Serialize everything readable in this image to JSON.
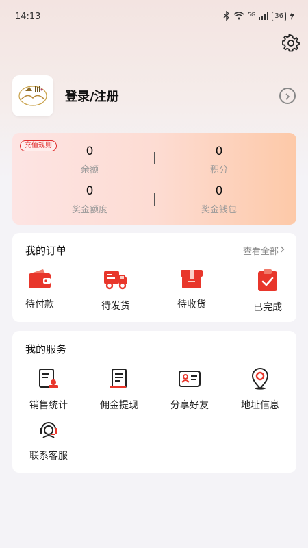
{
  "status_bar": {
    "time": "14:13",
    "network": "5G",
    "battery": "36"
  },
  "profile": {
    "login_label": "登录/注册",
    "avatar_icon": "logo-icon"
  },
  "wallet": {
    "recharge_rules": "充值规则",
    "stats": [
      {
        "value": "0",
        "label": "余额"
      },
      {
        "value": "0",
        "label": "积分"
      },
      {
        "value": "0",
        "label": "奖金额度"
      },
      {
        "value": "0",
        "label": "奖金钱包"
      }
    ]
  },
  "orders": {
    "title": "我的订单",
    "view_all": "查看全部",
    "items": [
      {
        "label": "待付款",
        "icon": "wallet-icon"
      },
      {
        "label": "待发货",
        "icon": "truck-icon"
      },
      {
        "label": "待收货",
        "icon": "box-icon"
      },
      {
        "label": "已完成",
        "icon": "clipboard-check-icon"
      }
    ]
  },
  "services": {
    "title": "我的服务",
    "items": [
      {
        "label": "销售统计",
        "icon": "sales-report-icon"
      },
      {
        "label": "佣金提现",
        "icon": "commission-doc-icon"
      },
      {
        "label": "分享好友",
        "icon": "id-card-icon"
      },
      {
        "label": "地址信息",
        "icon": "location-pin-icon"
      },
      {
        "label": "联系客服",
        "icon": "headset-icon"
      }
    ]
  },
  "colors": {
    "accent": "#e8362b",
    "card_gradient_start": "#fde4e3",
    "card_gradient_end": "#fdc9a8"
  }
}
